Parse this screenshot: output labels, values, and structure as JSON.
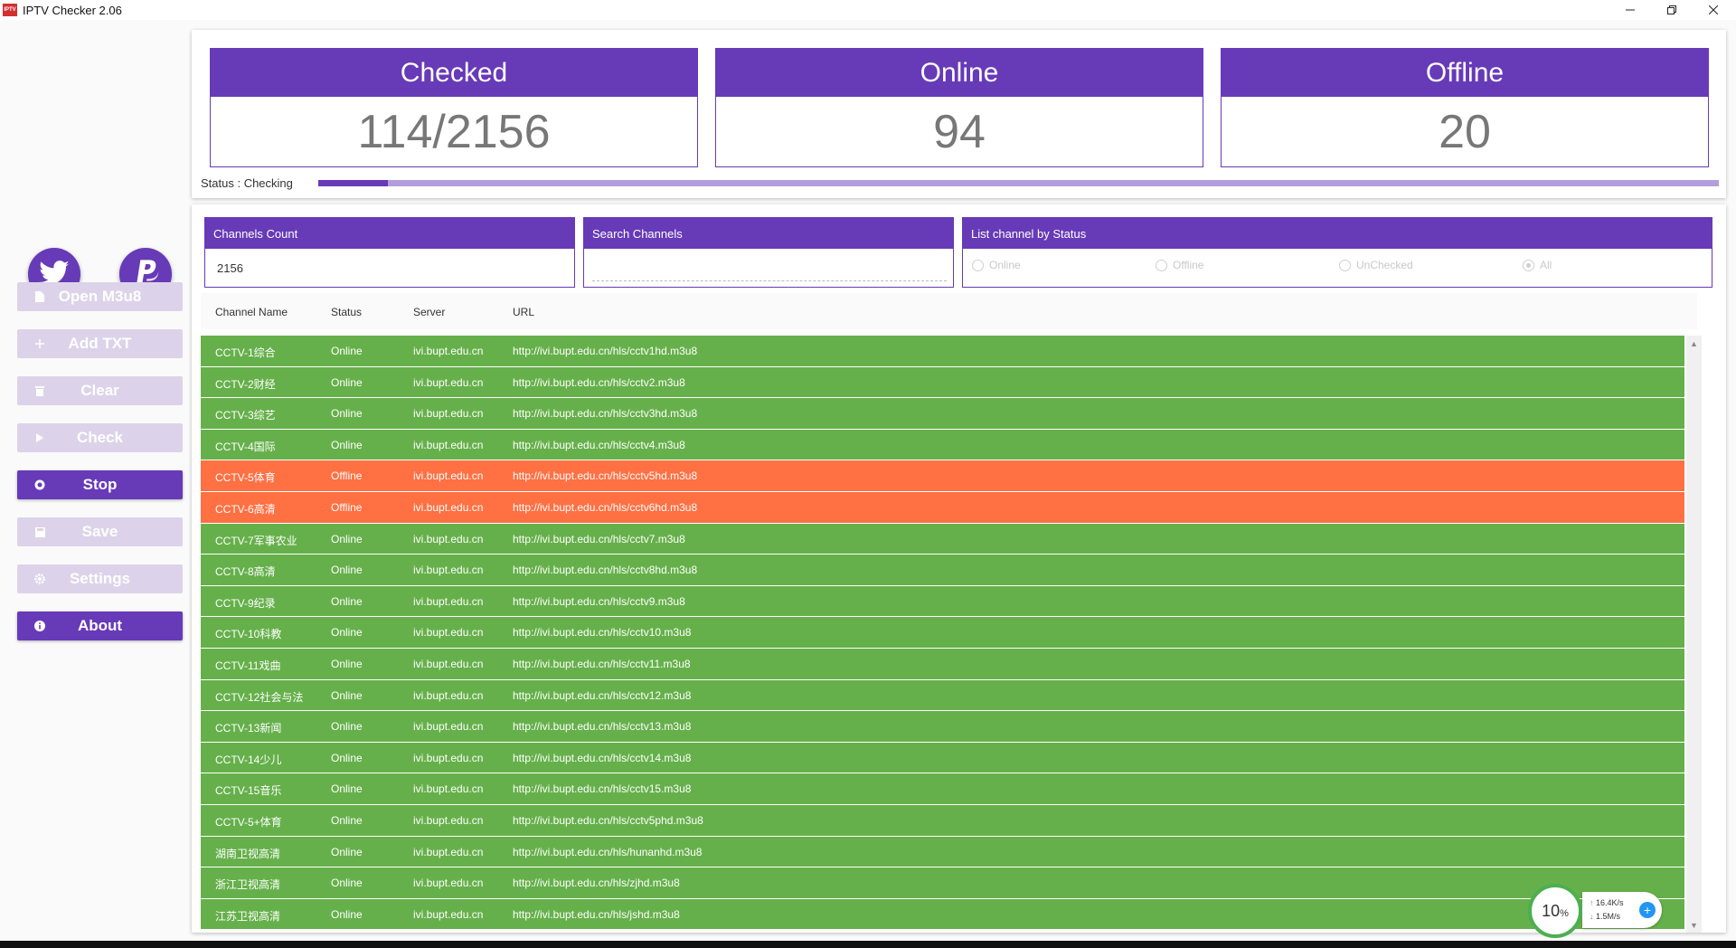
{
  "window": {
    "title": "IPTV Checker 2.06",
    "icon_text": "IPTV"
  },
  "sidebar": {
    "buttons": [
      {
        "label": "Open M3u8",
        "icon": "file-icon",
        "state": "disabled"
      },
      {
        "label": "Add TXT",
        "icon": "plus-icon",
        "state": "disabled"
      },
      {
        "label": "Clear",
        "icon": "trash-icon",
        "state": "disabled"
      },
      {
        "label": "Check",
        "icon": "play-icon",
        "state": "disabled"
      },
      {
        "label": "Stop",
        "icon": "stop-icon",
        "state": "active"
      },
      {
        "label": "Save",
        "icon": "save-icon",
        "state": "disabled"
      },
      {
        "label": "Settings",
        "icon": "gear-icon",
        "state": "disabled"
      },
      {
        "label": "About",
        "icon": "info-icon",
        "state": "active"
      }
    ]
  },
  "stats": {
    "checked_label": "Checked",
    "checked_value": "114/2156",
    "online_label": "Online",
    "online_value": "94",
    "offline_label": "Offline",
    "offline_value": "20"
  },
  "status": {
    "text": "Status : Checking",
    "progress": 0.05
  },
  "channels_box": {
    "label": "Channels Count",
    "value": "2156"
  },
  "search_box": {
    "label": "Search Channels",
    "value": ""
  },
  "filter_box": {
    "label": "List channel by Status",
    "options": [
      {
        "label": "Online",
        "checked": false
      },
      {
        "label": "Offline",
        "checked": false
      },
      {
        "label": "UnChecked",
        "checked": false
      },
      {
        "label": "All",
        "checked": true
      }
    ]
  },
  "table": {
    "columns": [
      "Channel Name",
      "Status",
      "Server",
      "URL"
    ],
    "rows": [
      {
        "name": "CCTV-1综合",
        "status": "Online",
        "server": "ivi.bupt.edu.cn",
        "url": "http://ivi.bupt.edu.cn/hls/cctv1hd.m3u8"
      },
      {
        "name": "CCTV-2财经",
        "status": "Online",
        "server": "ivi.bupt.edu.cn",
        "url": "http://ivi.bupt.edu.cn/hls/cctv2.m3u8"
      },
      {
        "name": "CCTV-3综艺",
        "status": "Online",
        "server": "ivi.bupt.edu.cn",
        "url": "http://ivi.bupt.edu.cn/hls/cctv3hd.m3u8"
      },
      {
        "name": "CCTV-4国际",
        "status": "Online",
        "server": "ivi.bupt.edu.cn",
        "url": "http://ivi.bupt.edu.cn/hls/cctv4.m3u8"
      },
      {
        "name": "CCTV-5体育",
        "status": "Offline",
        "server": "ivi.bupt.edu.cn",
        "url": "http://ivi.bupt.edu.cn/hls/cctv5hd.m3u8"
      },
      {
        "name": "CCTV-6高清",
        "status": "Offline",
        "server": "ivi.bupt.edu.cn",
        "url": "http://ivi.bupt.edu.cn/hls/cctv6hd.m3u8"
      },
      {
        "name": "CCTV-7军事农业",
        "status": "Online",
        "server": "ivi.bupt.edu.cn",
        "url": "http://ivi.bupt.edu.cn/hls/cctv7.m3u8"
      },
      {
        "name": "CCTV-8高清",
        "status": "Online",
        "server": "ivi.bupt.edu.cn",
        "url": "http://ivi.bupt.edu.cn/hls/cctv8hd.m3u8"
      },
      {
        "name": "CCTV-9纪录",
        "status": "Online",
        "server": "ivi.bupt.edu.cn",
        "url": "http://ivi.bupt.edu.cn/hls/cctv9.m3u8"
      },
      {
        "name": "CCTV-10科教",
        "status": "Online",
        "server": "ivi.bupt.edu.cn",
        "url": "http://ivi.bupt.edu.cn/hls/cctv10.m3u8"
      },
      {
        "name": "CCTV-11戏曲",
        "status": "Online",
        "server": "ivi.bupt.edu.cn",
        "url": "http://ivi.bupt.edu.cn/hls/cctv11.m3u8"
      },
      {
        "name": "CCTV-12社会与法",
        "status": "Online",
        "server": "ivi.bupt.edu.cn",
        "url": "http://ivi.bupt.edu.cn/hls/cctv12.m3u8"
      },
      {
        "name": "CCTV-13新闻",
        "status": "Online",
        "server": "ivi.bupt.edu.cn",
        "url": "http://ivi.bupt.edu.cn/hls/cctv13.m3u8"
      },
      {
        "name": "CCTV-14少儿",
        "status": "Online",
        "server": "ivi.bupt.edu.cn",
        "url": "http://ivi.bupt.edu.cn/hls/cctv14.m3u8"
      },
      {
        "name": "CCTV-15音乐",
        "status": "Online",
        "server": "ivi.bupt.edu.cn",
        "url": "http://ivi.bupt.edu.cn/hls/cctv15.m3u8"
      },
      {
        "name": "CCTV-5+体育",
        "status": "Online",
        "server": "ivi.bupt.edu.cn",
        "url": "http://ivi.bupt.edu.cn/hls/cctv5phd.m3u8"
      },
      {
        "name": "湖南卫视高清",
        "status": "Online",
        "server": "ivi.bupt.edu.cn",
        "url": "http://ivi.bupt.edu.cn/hls/hunanhd.m3u8"
      },
      {
        "name": "浙江卫视高清",
        "status": "Online",
        "server": "ivi.bupt.edu.cn",
        "url": "http://ivi.bupt.edu.cn/hls/zjhd.m3u8"
      },
      {
        "name": "江苏卫视高清",
        "status": "Online",
        "server": "ivi.bupt.edu.cn",
        "url": "http://ivi.bupt.edu.cn/hls/jshd.m3u8"
      }
    ]
  },
  "network_widget": {
    "percent": "10",
    "percent_unit": "%",
    "upload": "16.4K/s",
    "download": "1.5M/s"
  },
  "colors": {
    "primary": "#673ab7",
    "online_row": "#66b04b",
    "offline_row": "#ff7043",
    "disabled_button": "#dcd3ea"
  }
}
